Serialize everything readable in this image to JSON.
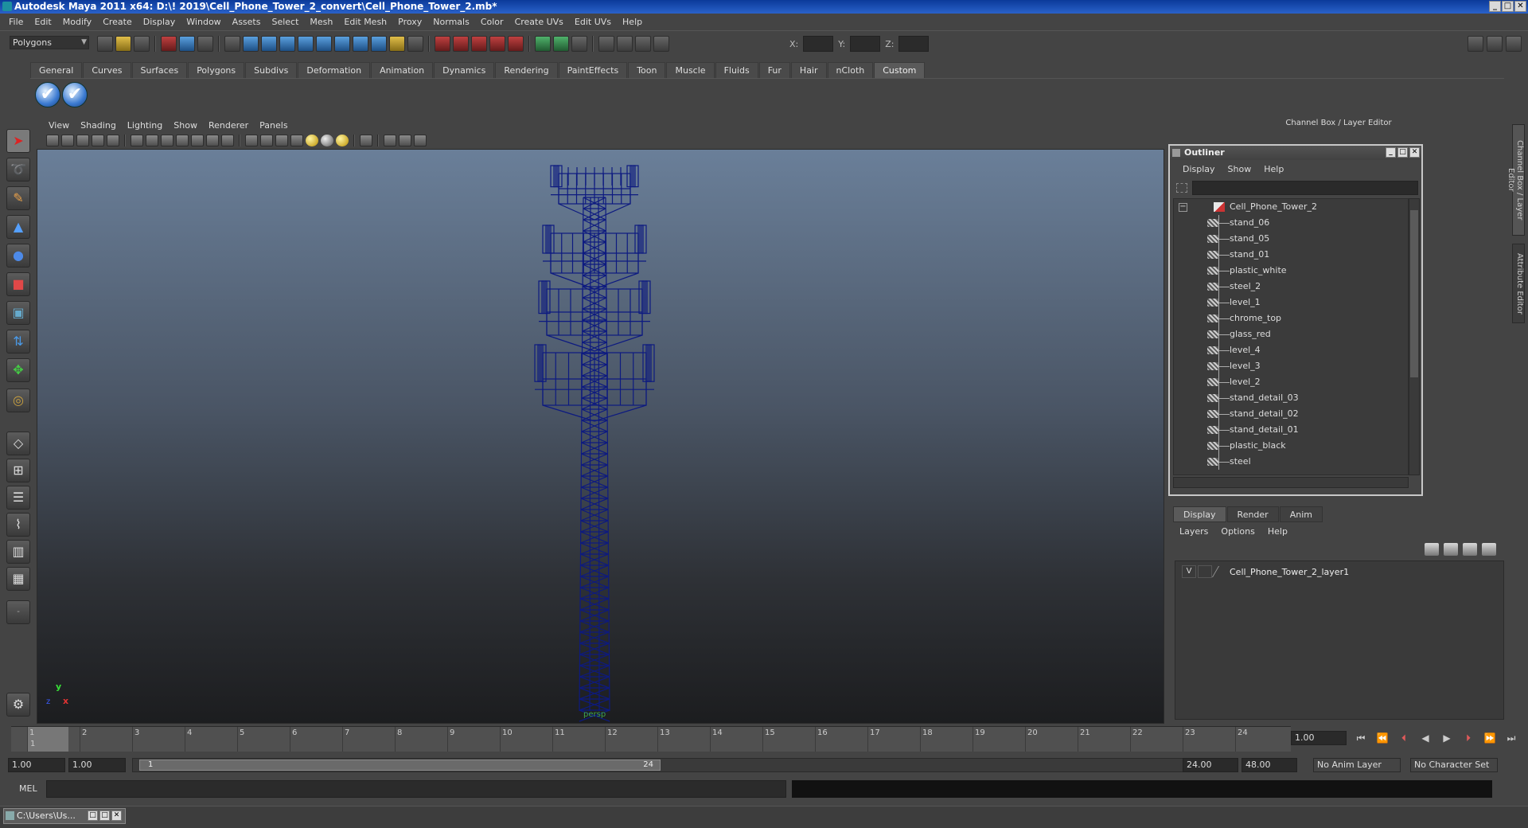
{
  "window": {
    "title": "Autodesk Maya 2011 x64: D:\\! 2019\\Cell_Phone_Tower_2_convert\\Cell_Phone_Tower_2.mb*",
    "min": "_",
    "max": "□",
    "close": "✕"
  },
  "menubar": [
    "File",
    "Edit",
    "Modify",
    "Create",
    "Display",
    "Window",
    "Assets",
    "Select",
    "Mesh",
    "Edit Mesh",
    "Proxy",
    "Normals",
    "Color",
    "Create UVs",
    "Edit UVs",
    "Help"
  ],
  "toolbar": {
    "mode": "Polygons",
    "x_label": "X:",
    "y_label": "Y:",
    "z_label": "Z:"
  },
  "shelf": {
    "tabs": [
      "General",
      "Curves",
      "Surfaces",
      "Polygons",
      "Subdivs",
      "Deformation",
      "Animation",
      "Dynamics",
      "Rendering",
      "PaintEffects",
      "Toon",
      "Muscle",
      "Fluids",
      "Fur",
      "Hair",
      "nCloth",
      "Custom"
    ],
    "active_tab": "Custom",
    "button_glyph": "✔"
  },
  "viewport": {
    "menu": [
      "View",
      "Shading",
      "Lighting",
      "Show",
      "Renderer",
      "Panels"
    ],
    "camera": "persp",
    "axis_x": "x",
    "axis_y": "y",
    "axis_z": "z",
    "model_color": "#0d1a80"
  },
  "channel_box": {
    "header": "Channel Box / Layer Editor",
    "side_tabs": [
      "Channel Box / Layer Editor",
      "Attribute Editor"
    ]
  },
  "outliner": {
    "title": "Outliner",
    "menu": [
      "Display",
      "Show",
      "Help"
    ],
    "root": "Cell_Phone_Tower_2",
    "items": [
      "stand_06",
      "stand_05",
      "stand_01",
      "plastic_white",
      "steel_2",
      "level_1",
      "chrome_top",
      "glass_red",
      "level_4",
      "level_3",
      "level_2",
      "stand_detail_03",
      "stand_detail_02",
      "stand_detail_01",
      "plastic_black",
      "steel"
    ]
  },
  "layer_editor": {
    "tabs": [
      "Display",
      "Render",
      "Anim"
    ],
    "active_tab": "Display",
    "menu": [
      "Layers",
      "Options",
      "Help"
    ],
    "layer_visible": "V",
    "layer_name": "Cell_Phone_Tower_2_layer1"
  },
  "timeline": {
    "ticks": [
      "1",
      "2",
      "3",
      "4",
      "5",
      "6",
      "7",
      "8",
      "9",
      "10",
      "11",
      "12",
      "13",
      "14",
      "15",
      "16",
      "17",
      "18",
      "19",
      "20",
      "21",
      "22",
      "23",
      "24"
    ],
    "current_frame_marker": "1",
    "current_frame": "1.00"
  },
  "range": {
    "start": "1.00",
    "playback_start": "1.00",
    "slider_low": "1",
    "slider_high": "24",
    "playback_end": "24.00",
    "end": "48.00",
    "anim_layer": "No Anim Layer",
    "character_set": "No Character Set"
  },
  "command": {
    "label": "MEL"
  },
  "taskbar": {
    "item": "C:\\Users\\Us..."
  }
}
